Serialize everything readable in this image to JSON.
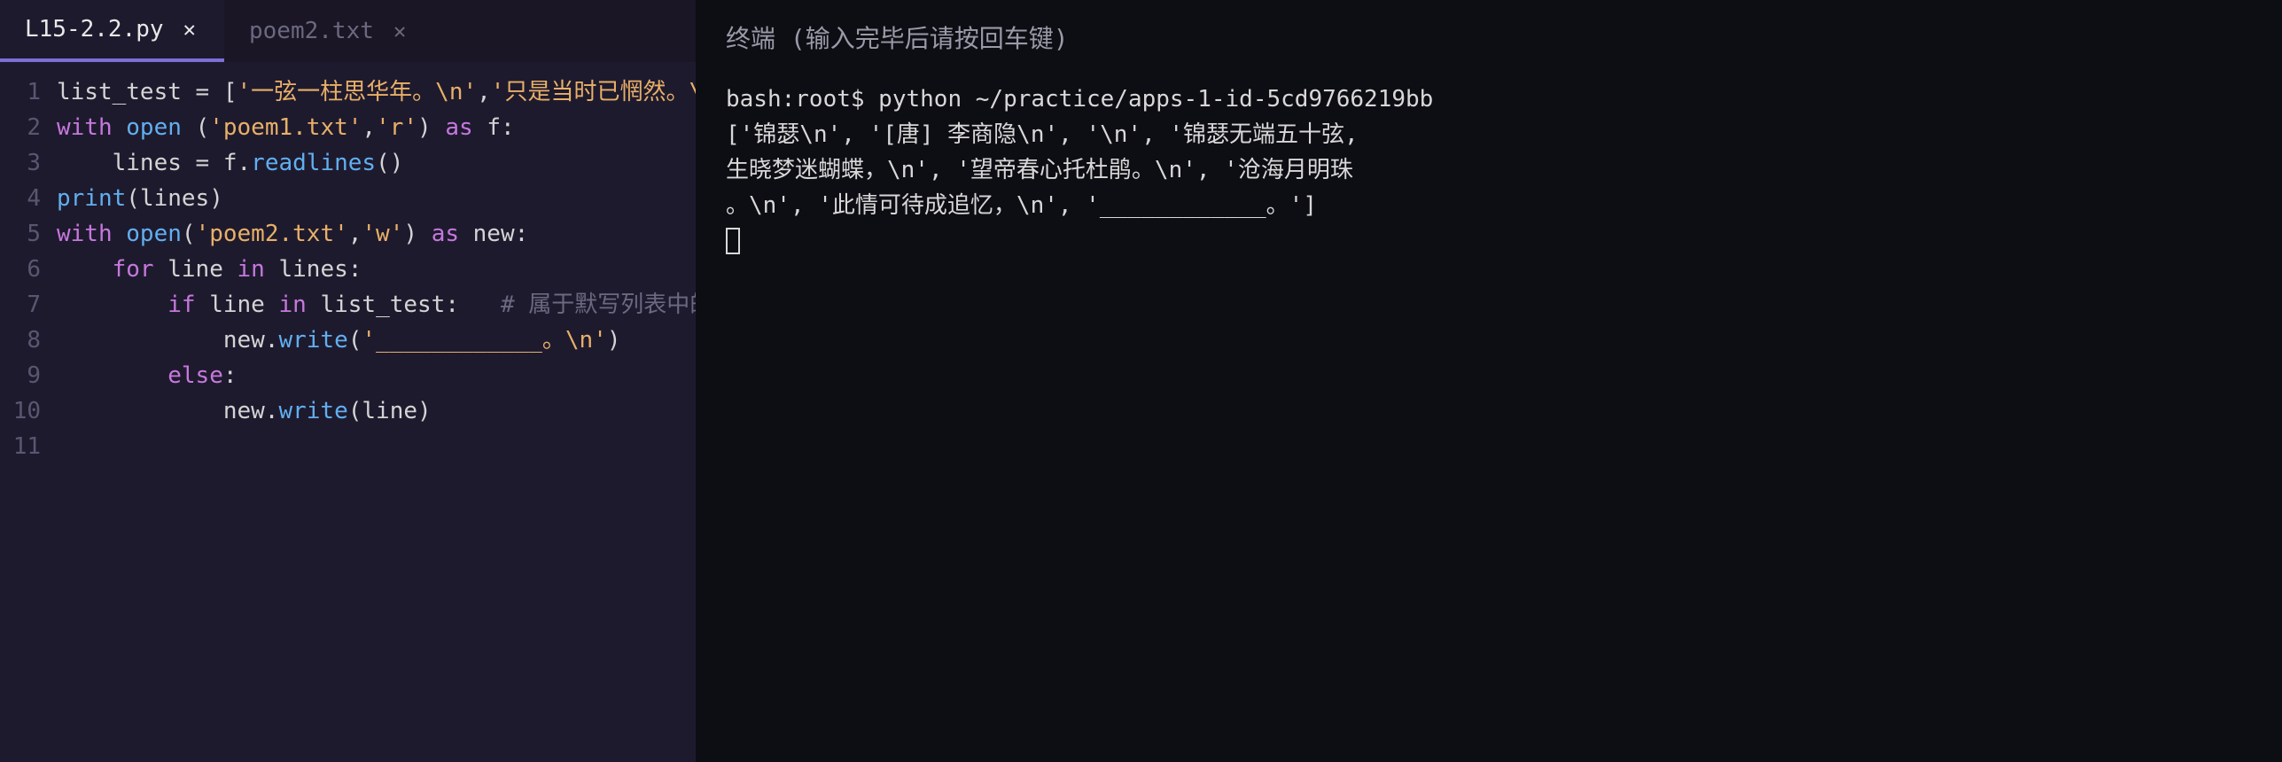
{
  "tabs": [
    {
      "label": "L15-2.2.py",
      "active": true
    },
    {
      "label": "poem2.txt",
      "active": false
    }
  ],
  "code": {
    "lines": [
      [
        {
          "t": "list_test ",
          "c": "tk-var"
        },
        {
          "t": "= ",
          "c": "tk-op"
        },
        {
          "t": "[",
          "c": "tk-punc"
        },
        {
          "t": "'一弦一柱思华年。\\n'",
          "c": "tk-str"
        },
        {
          "t": ",",
          "c": "tk-punc"
        },
        {
          "t": "'只是当时已惘然。\\n",
          "c": "tk-str"
        }
      ],
      [
        {
          "t": "with ",
          "c": "tk-kw"
        },
        {
          "t": "open ",
          "c": "tk-func"
        },
        {
          "t": "(",
          "c": "tk-paren"
        },
        {
          "t": "'poem1.txt'",
          "c": "tk-str"
        },
        {
          "t": ",",
          "c": "tk-punc"
        },
        {
          "t": "'r'",
          "c": "tk-str"
        },
        {
          "t": ") ",
          "c": "tk-paren"
        },
        {
          "t": "as ",
          "c": "tk-kw"
        },
        {
          "t": "f:",
          "c": "tk-var"
        }
      ],
      [
        {
          "t": "    lines ",
          "c": "tk-var"
        },
        {
          "t": "= ",
          "c": "tk-op"
        },
        {
          "t": "f.",
          "c": "tk-var"
        },
        {
          "t": "readlines",
          "c": "tk-func"
        },
        {
          "t": "()",
          "c": "tk-paren"
        }
      ],
      [
        {
          "t": "print",
          "c": "tk-func"
        },
        {
          "t": "(",
          "c": "tk-paren"
        },
        {
          "t": "lines",
          "c": "tk-var"
        },
        {
          "t": ")",
          "c": "tk-paren"
        }
      ],
      [
        {
          "t": "with ",
          "c": "tk-kw"
        },
        {
          "t": "open",
          "c": "tk-func"
        },
        {
          "t": "(",
          "c": "tk-paren"
        },
        {
          "t": "'poem2.txt'",
          "c": "tk-str"
        },
        {
          "t": ",",
          "c": "tk-punc"
        },
        {
          "t": "'w'",
          "c": "tk-str"
        },
        {
          "t": ") ",
          "c": "tk-paren"
        },
        {
          "t": "as ",
          "c": "tk-kw"
        },
        {
          "t": "new:",
          "c": "tk-var"
        }
      ],
      [
        {
          "t": "    ",
          "c": "tk-var"
        },
        {
          "t": "for ",
          "c": "tk-kw"
        },
        {
          "t": "line ",
          "c": "tk-var"
        },
        {
          "t": "in ",
          "c": "tk-kw"
        },
        {
          "t": "lines:",
          "c": "tk-var"
        }
      ],
      [
        {
          "t": "        ",
          "c": "tk-var"
        },
        {
          "t": "if ",
          "c": "tk-kw"
        },
        {
          "t": "line ",
          "c": "tk-var"
        },
        {
          "t": "in ",
          "c": "tk-kw"
        },
        {
          "t": "list_test:   ",
          "c": "tk-var"
        },
        {
          "t": "# 属于默写列表中的句",
          "c": "tk-comment"
        }
      ],
      [
        {
          "t": "            new.",
          "c": "tk-var"
        },
        {
          "t": "write",
          "c": "tk-func"
        },
        {
          "t": "(",
          "c": "tk-paren"
        },
        {
          "t": "'____________。\\n'",
          "c": "tk-str"
        },
        {
          "t": ")",
          "c": "tk-paren"
        }
      ],
      [
        {
          "t": "        ",
          "c": "tk-var"
        },
        {
          "t": "else",
          "c": "tk-kw"
        },
        {
          "t": ":",
          "c": "tk-var"
        }
      ],
      [
        {
          "t": "            new.",
          "c": "tk-var"
        },
        {
          "t": "write",
          "c": "tk-func"
        },
        {
          "t": "(",
          "c": "tk-paren"
        },
        {
          "t": "line",
          "c": "tk-var"
        },
        {
          "t": ")",
          "c": "tk-paren"
        }
      ],
      []
    ],
    "lineNumbers": [
      "1",
      "2",
      "3",
      "4",
      "5",
      "6",
      "7",
      "8",
      "9",
      "10",
      "11"
    ]
  },
  "terminal": {
    "header": "终端 (输入完毕后请按回车键)",
    "lines": [
      "bash:root$ python ~/practice/apps-1-id-5cd9766219bb",
      "['锦瑟\\n', '[唐] 李商隐\\n', '\\n', '锦瑟无端五十弦,",
      "生晓梦迷蝴蝶，\\n', '望帝春心托杜鹃。\\n', '沧海月明珠",
      "。\\n', '此情可待成追忆，\\n', '____________。']"
    ]
  }
}
